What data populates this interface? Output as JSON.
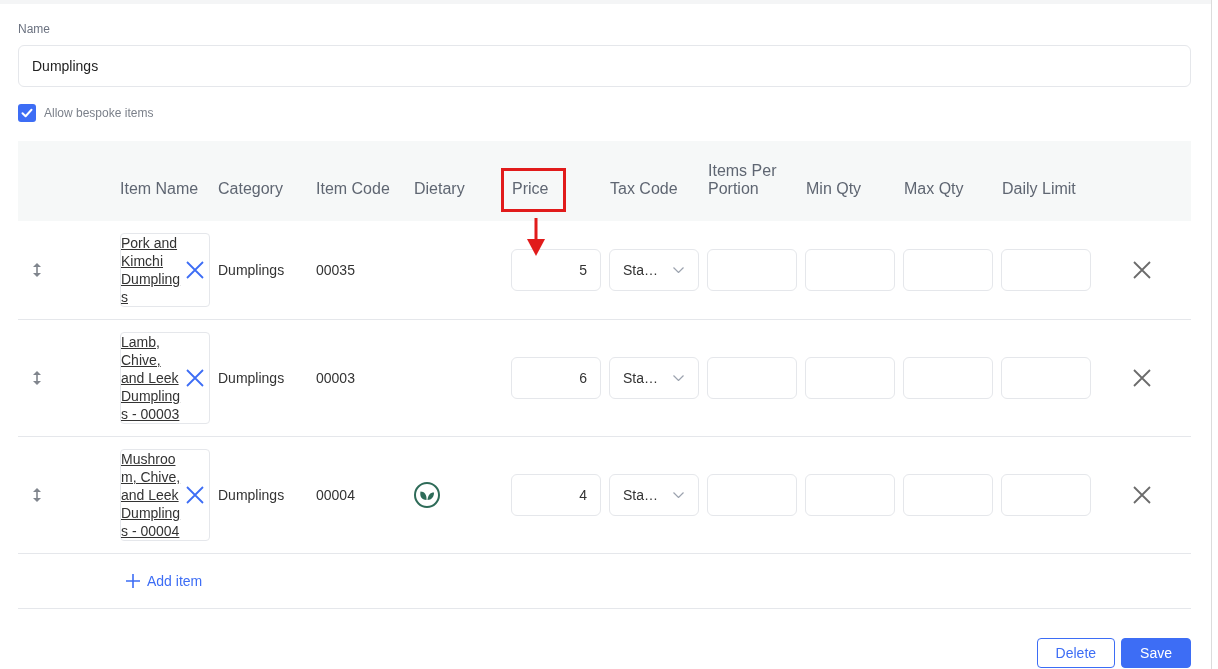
{
  "name_field": {
    "label": "Name",
    "value": "Dumplings"
  },
  "allow_bespoke": {
    "label": "Allow bespoke items",
    "checked": true
  },
  "table": {
    "columns": [
      {
        "label": "Item Name",
        "highlighted": false
      },
      {
        "label": "Category",
        "highlighted": false
      },
      {
        "label": "Item Code",
        "highlighted": false
      },
      {
        "label": "Dietary",
        "highlighted": false
      },
      {
        "label": "Price",
        "highlighted": true
      },
      {
        "label": "Tax Code",
        "highlighted": false
      },
      {
        "label": "Items Per Portion",
        "highlighted": false
      },
      {
        "label": "Min Qty",
        "highlighted": false
      },
      {
        "label": "Max Qty",
        "highlighted": false
      },
      {
        "label": "Daily Limit",
        "highlighted": false
      }
    ],
    "rows": [
      {
        "item_name": "Pork and Kimchi Dumplings",
        "category": "Dumplings",
        "item_code": "00035",
        "dietary_leaf": false,
        "price": "5",
        "tax_code": "Sta…"
      },
      {
        "item_name": "Lamb, Chive, and Leek Dumplings - 00003",
        "category": "Dumplings",
        "item_code": "00003",
        "dietary_leaf": false,
        "price": "6",
        "tax_code": "Sta…"
      },
      {
        "item_name": "Mushroom, Chive, and Leek Dumplings - 00004",
        "category": "Dumplings",
        "item_code": "00004",
        "dietary_leaf": true,
        "price": "4",
        "tax_code": "Sta…"
      }
    ]
  },
  "add_item": "Add item",
  "buttons": [
    {
      "label": "Delete",
      "kind": "secondary"
    },
    {
      "label": "Save",
      "kind": "primary"
    }
  ]
}
